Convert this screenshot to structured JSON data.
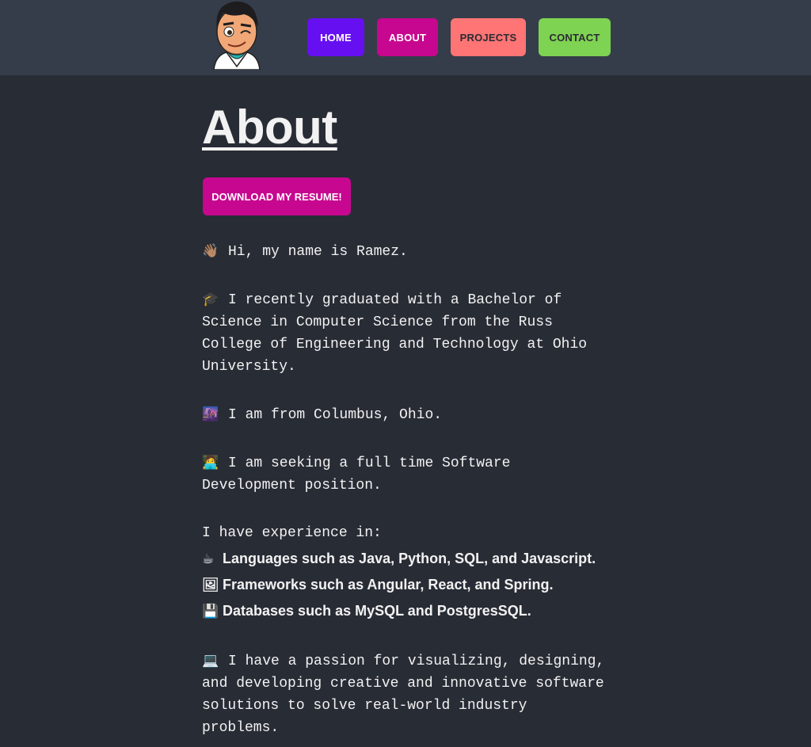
{
  "nav": {
    "home": "HOME",
    "about": "ABOUT",
    "projects": "PROJECTS",
    "contact": "CONTACT"
  },
  "page": {
    "title": "About",
    "resume_button": "DOWNLOAD MY RESUME!"
  },
  "about": {
    "greeting_emoji": "👋🏽",
    "greeting": "Hi, my name is Ramez.",
    "education_emoji": "🎓",
    "education": "I recently graduated with a Bachelor of Science in Computer Science from the Russ College of Engineering and Technology at Ohio University.",
    "location_emoji": "🌆",
    "location": "I am from Columbus, Ohio.",
    "seeking_emoji": "🧑‍💻",
    "seeking": "I am seeking a full time Software Development position.",
    "experience_intro": "I have experience in:",
    "experience": [
      {
        "emoji": "☕",
        "text": "Languages such as Java, Python, SQL, and Javascript."
      },
      {
        "emoji": "🖼",
        "text": "Frameworks such as Angular, React, and Spring."
      },
      {
        "emoji": "💾",
        "text": "Databases such as MySQL and PostgresSQL."
      }
    ],
    "passion_emoji": "💻",
    "passion": "I have a passion for visualizing, designing, and developing creative and innovative software solutions to solve real-world industry problems."
  },
  "colors": {
    "background": "#282c35",
    "topbar": "#353d4a",
    "home": "#6610f2",
    "about": "#c7078f",
    "projects": "#ff7474",
    "contact": "#7ed352"
  }
}
